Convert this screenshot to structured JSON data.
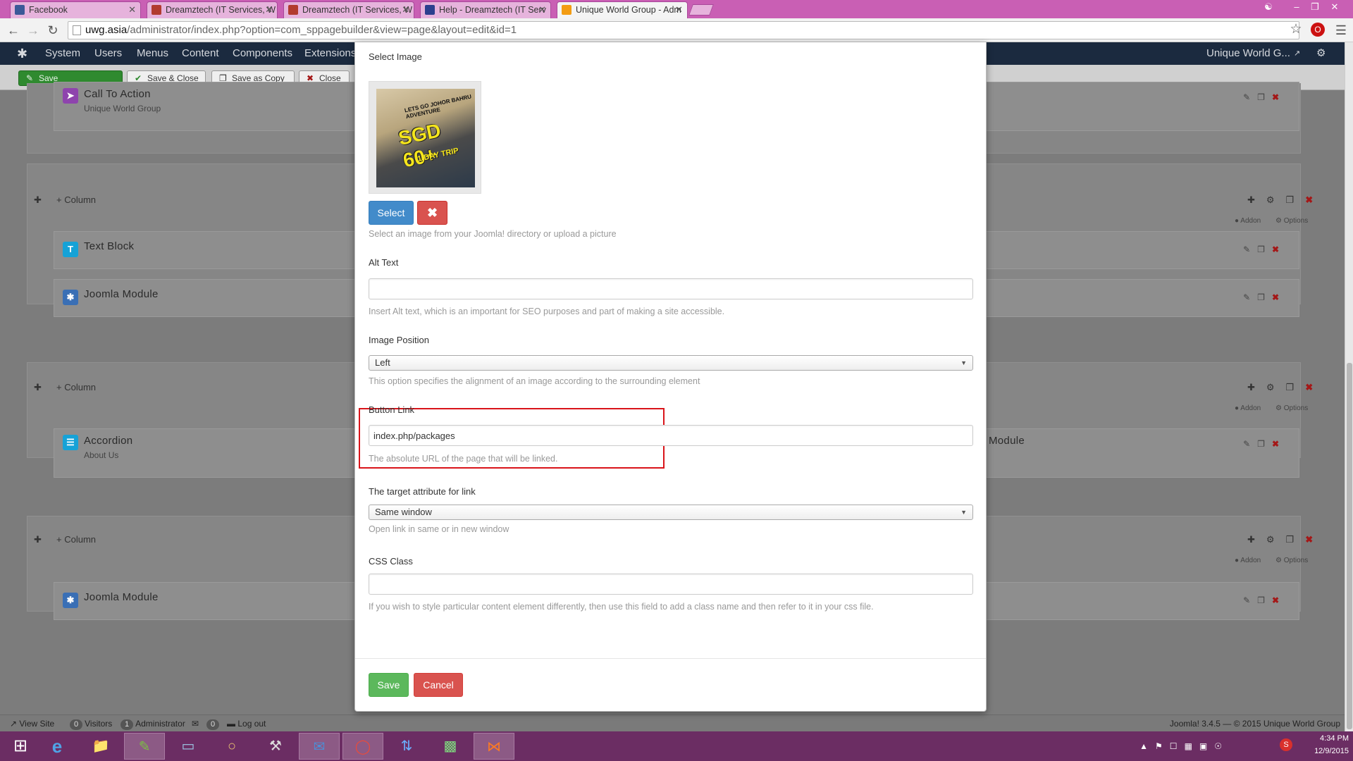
{
  "colors": {
    "tabbar": "#c95fb4",
    "taskbar": "#6b2d63",
    "primary": "#428bca",
    "success": "#5cb85c",
    "danger": "#d9534f",
    "highlight": "#d9141a"
  },
  "browser": {
    "tabs": [
      {
        "title": "Facebook",
        "icon": "facebook-icon"
      },
      {
        "title": "Dreamztech (IT Services, W",
        "icon": "joomla-icon"
      },
      {
        "title": "Dreamztech (IT Services, W",
        "icon": "joomla-icon"
      },
      {
        "title": "Help - Dreamztech (IT Serv",
        "icon": "joomla-icon"
      },
      {
        "title": "Unique World Group - Adm",
        "icon": "joomla-icon"
      }
    ],
    "url_host": "uwg.asia",
    "url_path": "/administrator/index.php?option=com_sppagebuilder&view=page&layout=edit&id=1"
  },
  "admin": {
    "menu": [
      "System",
      "Users",
      "Menus",
      "Content",
      "Components",
      "Extensions"
    ],
    "site_name": "Unique World G...",
    "toolbar": {
      "save": "Save",
      "save_close": "Save & Close",
      "save_copy": "Save as Copy",
      "close": "Close"
    },
    "column_label": "Column",
    "addon_link": "Addon",
    "options_link": "Options",
    "addons": [
      {
        "name": "Call To Action",
        "sub": "Unique World Group"
      },
      {
        "name": "Text Block",
        "sub": ""
      },
      {
        "name": "Joomla Module",
        "sub": ""
      },
      {
        "name": "Accordion",
        "sub": "About Us"
      },
      {
        "name": "Joomla Module",
        "sub": ""
      }
    ],
    "partial_module_label": "Module",
    "status": {
      "view_site": "View Site",
      "visitors_count": "0",
      "visitors": "Visitors",
      "admin_count": "1",
      "administrator": "Administrator",
      "messages_count": "0",
      "logout": "Log out",
      "copyright": "Joomla! 3.4.5 — © 2015 Unique World Group"
    }
  },
  "modal": {
    "select_image_label": "Select Image",
    "image_text": {
      "line1": "LETS GO JOHOR BAHRU ADVENTURE",
      "line2": "SGD 60+",
      "line3": "1 DAY TRIP"
    },
    "select_button": "Select",
    "select_help": "Select an image from your Joomla! directory or upload a picture",
    "alt_label": "Alt Text",
    "alt_value": "",
    "alt_help": "Insert Alt text, which is an important for SEO purposes and part of making a site accessible.",
    "position_label": "Image Position",
    "position_value": "Left",
    "position_help": "This option specifies the alignment of an image according to the surrounding element",
    "link_label": "Button Link",
    "link_value": "index.php/packages",
    "link_help": "The absolute URL of the page that will be linked.",
    "target_label": "The target attribute for link",
    "target_value": "Same window",
    "target_help": "Open link in same or in new window",
    "css_label": "CSS Class",
    "css_value": "",
    "css_help": "If you wish to style particular content element differently, then use this field to add a class name and then refer to it in your css file.",
    "save": "Save",
    "cancel": "Cancel"
  },
  "taskbar": {
    "time": "4:34 PM",
    "date": "12/9/2015",
    "apps": [
      "start-icon",
      "internet-explorer-icon",
      "file-explorer-icon",
      "notepad-icon",
      "app-icon",
      "paint-icon",
      "tool-icon",
      "thunderbird-icon",
      "chrome-icon",
      "network-icon",
      "network-icon-2",
      "xampp-icon"
    ]
  }
}
